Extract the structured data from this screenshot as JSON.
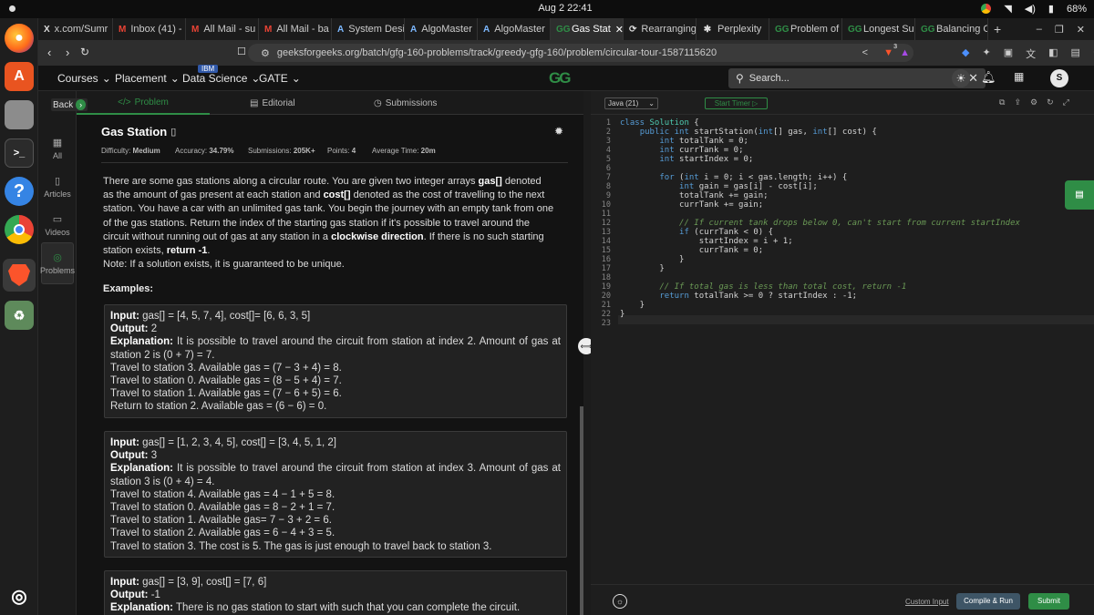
{
  "system": {
    "clock": "Aug 2  22:41",
    "battery": "68%"
  },
  "dock": [
    "firefox-icon",
    "app-center-icon",
    "files-icon",
    "terminal-icon",
    "help-icon",
    "chrome-icon",
    "brave-icon",
    "trash-icon",
    "ubuntu-icon"
  ],
  "tabs": [
    {
      "fav": "X",
      "label": "x.com/Sumr"
    },
    {
      "fav": "M",
      "label": "Inbox (41) -"
    },
    {
      "fav": "M",
      "label": "All Mail - su"
    },
    {
      "fav": "M",
      "label": "All Mail - ba"
    },
    {
      "fav": "A",
      "label": "System Desi"
    },
    {
      "fav": "A",
      "label": "AlgoMaster"
    },
    {
      "fav": "A",
      "label": "AlgoMaster"
    },
    {
      "fav": "GG",
      "label": "Gas Stat",
      "active": true
    },
    {
      "fav": "⟳",
      "label": "Rearranging"
    },
    {
      "fav": "✱",
      "label": "Perplexity"
    },
    {
      "fav": "GG",
      "label": "Problem of"
    },
    {
      "fav": "GG",
      "label": "Longest Sul"
    },
    {
      "fav": "GG",
      "label": "Balancing C"
    }
  ],
  "url": "geeksforgeeks.org/batch/gfg-160-problems/track/greedy-gfg-160/problem/circular-tour-1587115620",
  "brave_badge": "3",
  "nav": {
    "courses": "Courses",
    "placement": "Placement",
    "data_science": "Data Science",
    "ibm": "IBM",
    "gate": "GATE",
    "logo": "GG",
    "search_placeholder": "Search...",
    "avatar": "S"
  },
  "rail": {
    "back": "Back",
    "all": "All",
    "articles": "Articles",
    "videos": "Videos",
    "problems": "Problems"
  },
  "panel_tabs": {
    "problem": "Problem",
    "editorial": "Editorial",
    "submissions": "Submissions"
  },
  "problem": {
    "title": "Gas Station",
    "difficulty_label": "Difficulty:",
    "difficulty": "Medium",
    "accuracy_label": "Accuracy:",
    "accuracy": "34.79%",
    "submissions_label": "Submissions:",
    "submissions": "205K+",
    "points_label": "Points:",
    "points": "4",
    "avg_label": "Average Time:",
    "avg": "20m",
    "desc_1": "There are some gas stations along a circular route. You are given two integer arrays ",
    "gas": "gas[]",
    "desc_2": " denoted as the amount of gas present at each station and ",
    "cost": "cost[]",
    "desc_3": " denoted as the cost of travelling to the next station. You have a car with an unlimited gas tank. You begin the journey with an empty tank from one of the gas stations. Return the index of the starting gas station if it's possible to travel around the circuit without running out of gas at any station in a ",
    "clockwise": "clockwise direction",
    "desc_4": ". If there is no such starting station exists, ",
    "return_neg": "return -1",
    "desc_5": ".",
    "note": "Note: If a solution exists, it is guaranteed to be unique.",
    "examples_label": "Examples:"
  },
  "examples": [
    {
      "input_label": "Input:",
      "input": " gas[] = [4, 5, 7, 4], cost[]= [6, 6, 3, 5]",
      "output_label": "Output:",
      "output": " 2",
      "exp_label": "Explanation:",
      "exp": " It is possible to travel around the circuit from station at index 2. Amount of gas at station 2 is (0 + 7) = 7.",
      "lines": [
        "Travel to station 3. Available gas = (7 − 3 + 4) = 8.",
        "Travel to station 0. Available gas = (8 − 5 + 4) = 7.",
        "Travel to station 1. Available gas = (7 − 6 + 5) = 6.",
        "Return to station 2. Available gas = (6 − 6) = 0."
      ]
    },
    {
      "input_label": "Input:",
      "input": " gas[] = [1, 2, 3, 4, 5], cost[] = [3, 4, 5, 1, 2]",
      "output_label": "Output:",
      "output": " 3",
      "exp_label": "Explanation:",
      "exp": " It is possible to travel around the circuit from station at index 3. Amount of gas at station 3 is (0 + 4) = 4.",
      "lines": [
        "Travel to station 4. Available gas = 4 − 1 + 5 = 8.",
        "Travel to station 0. Available gas = 8 − 2 + 1 = 7.",
        "Travel to station 1. Available gas= 7 − 3 + 2 = 6.",
        "Travel to station 2. Available gas = 6 − 4 + 3 = 5.",
        "Travel to station 3. The cost is 5. The gas is just enough to travel back to station 3."
      ]
    },
    {
      "input_label": "Input:",
      "input": " gas[] = [3, 9], cost[] = [7, 6]",
      "output_label": "Output:",
      "output": " -1",
      "exp_label": "Explanation:",
      "exp": " There is no gas station to start with such that you can complete the circuit.",
      "lines": []
    }
  ],
  "editor": {
    "language": "Java (21)",
    "timer": "Start Timer",
    "custom_input": "Custom Input",
    "compile": "Compile & Run",
    "submit": "Submit"
  },
  "code": [
    "class Solution {",
    "    public int startStation(int[] gas, int[] cost) {",
    "        int totalTank = 0;",
    "        int currTank = 0;",
    "        int startIndex = 0;",
    "",
    "        for (int i = 0; i < gas.length; i++) {",
    "            int gain = gas[i] - cost[i];",
    "            totalTank += gain;",
    "            currTank += gain;",
    "",
    "            // If current tank drops below 0, can't start from current startIndex",
    "            if (currTank < 0) {",
    "                startIndex = i + 1;",
    "                currTank = 0;",
    "            }",
    "        }",
    "",
    "        // If total gas is less than total cost, return -1",
    "        return totalTank >= 0 ? startIndex : -1;",
    "    }",
    "}",
    ""
  ],
  "colors": {
    "accent": "#2f8d46",
    "bg": "#131313",
    "editor_bg": "#1e1e1e"
  }
}
